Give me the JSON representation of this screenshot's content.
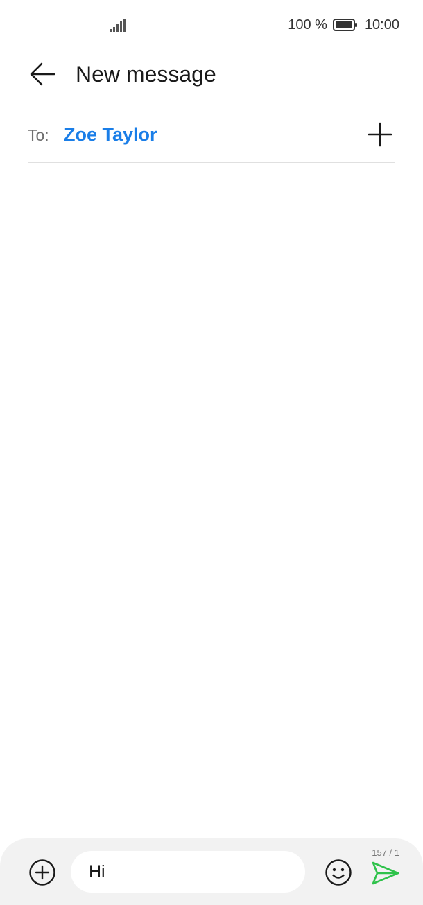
{
  "status_bar": {
    "battery_percent": "100 %",
    "time": "10:00",
    "signal_icon": "signal-bars-icon",
    "battery_icon": "battery-full-icon"
  },
  "header": {
    "title": "New message",
    "back_icon": "arrow-left-icon"
  },
  "recipient": {
    "to_label": "To:",
    "name": "Zoe Taylor",
    "add_icon": "plus-icon",
    "name_color": "#1a7ee8"
  },
  "compose": {
    "message_text": "Hi",
    "char_counter": "157 / 1",
    "attach_icon": "add-circle-icon",
    "emoji_icon": "smiley-icon",
    "send_icon": "send-arrow-icon",
    "send_color": "#2ec24a"
  }
}
